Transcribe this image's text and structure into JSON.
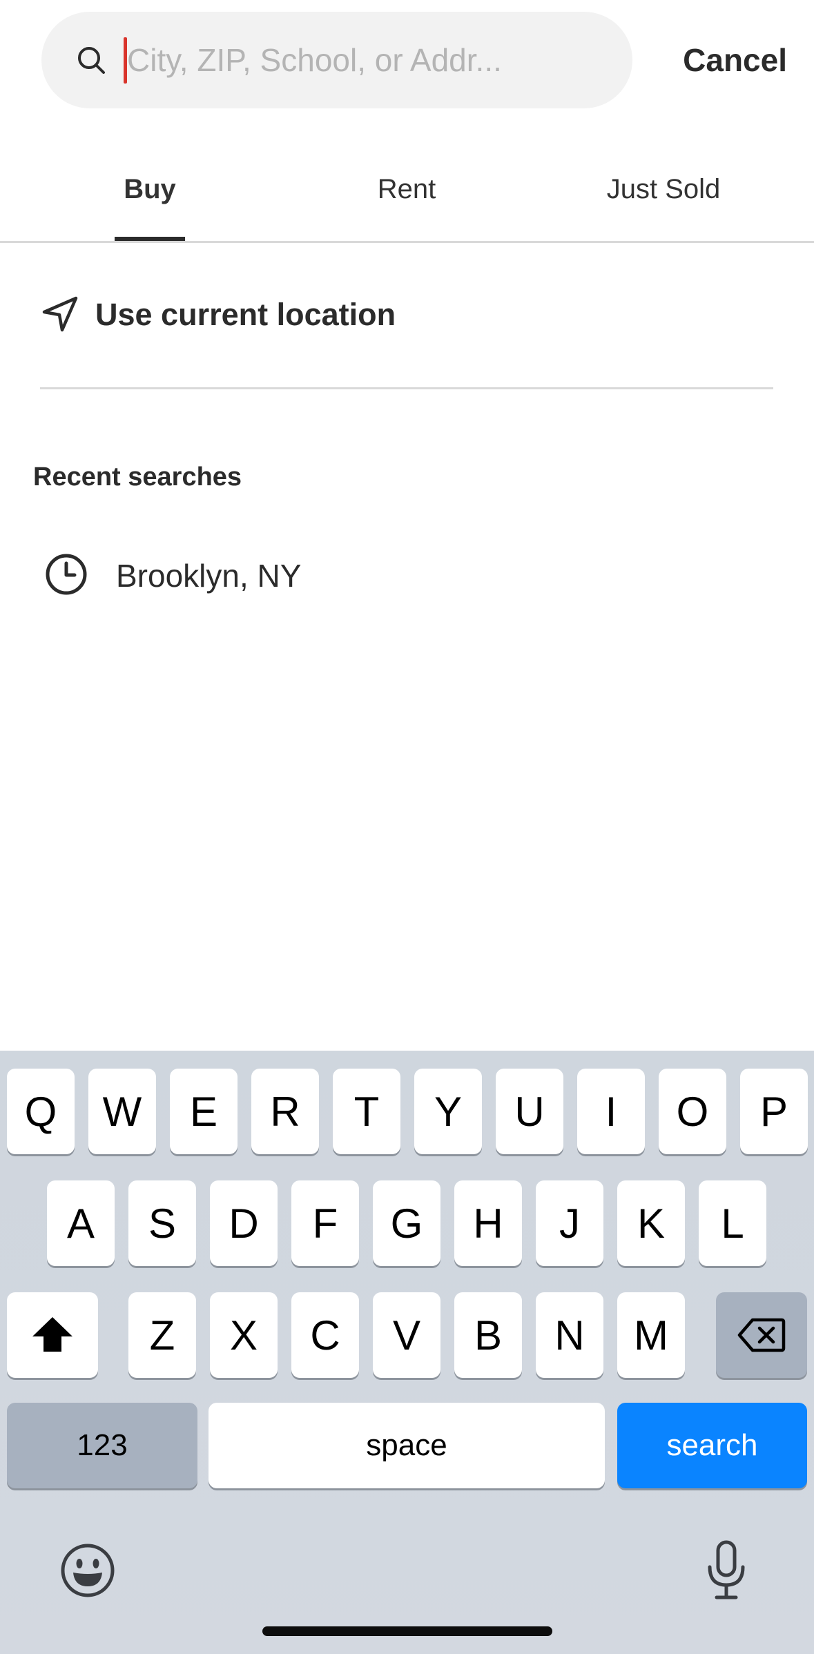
{
  "search": {
    "placeholder": "City, ZIP, School, or Addr...",
    "value": "",
    "cancel_label": "Cancel"
  },
  "tabs": [
    {
      "label": "Buy",
      "active": true
    },
    {
      "label": "Rent",
      "active": false
    },
    {
      "label": "Just Sold",
      "active": false
    }
  ],
  "location": {
    "label": "Use current location"
  },
  "recent": {
    "heading": "Recent searches",
    "items": [
      {
        "label": "Brooklyn, NY"
      }
    ]
  },
  "keyboard": {
    "row1": [
      "Q",
      "W",
      "E",
      "R",
      "T",
      "Y",
      "U",
      "I",
      "O",
      "P"
    ],
    "row2": [
      "A",
      "S",
      "D",
      "F",
      "G",
      "H",
      "J",
      "K",
      "L"
    ],
    "row3": [
      "Z",
      "X",
      "C",
      "V",
      "B",
      "N",
      "M"
    ],
    "numbers_label": "123",
    "space_label": "space",
    "search_label": "search"
  },
  "colors": {
    "accent_blue": "#0a84ff",
    "caret_red": "#d9342b",
    "text_dark": "#2b2b2b"
  }
}
